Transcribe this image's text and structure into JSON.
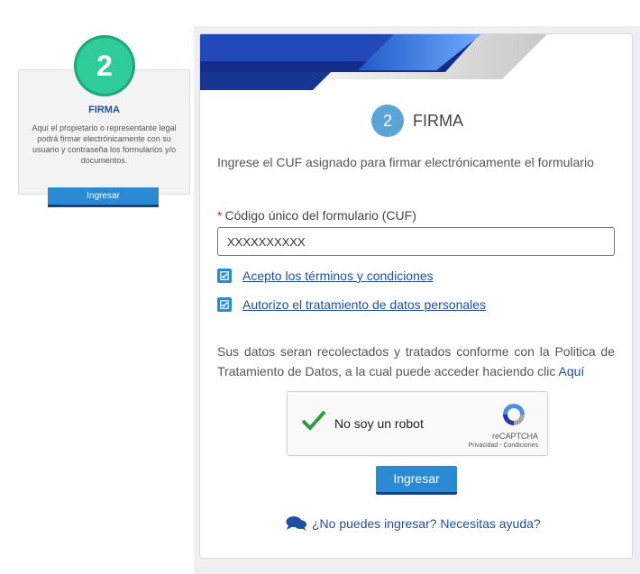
{
  "step_card": {
    "number": "2",
    "title": "FIRMA",
    "description": "Aquí el propietario o representante legal podrá firmar electrónicamente con su usuario y contraseña los formularios y/o documentos.",
    "button_label": "Ingresar"
  },
  "form": {
    "step_number": "2",
    "step_title": "FIRMA",
    "instruction": "Ingrese el CUF asignado para firmar electrónicamente el formulario",
    "required_mark": "*",
    "field_label": "Código único del formulario (CUF)",
    "field_value": "XXXXXXXXXX",
    "checkbox_terms": "Acepto los términos y condiciones",
    "checkbox_data": "Autorizo el tratamiento de datos personales",
    "privacy_text": "Sus datos seran recolectados y tratados conforme con la Politica de Tratamiento de Datos, a la cual puede acceder haciendo clic",
    "privacy_link": "Aquí",
    "submit_label": "Ingresar",
    "help_text": "¿No puedes ingresar? Necesitas ayuda?"
  },
  "recaptcha": {
    "label": "No soy un robot",
    "brand": "reCAPTCHA",
    "terms": "Privacidad - Condiciones"
  },
  "colors": {
    "accent_green": "#2ecc9a",
    "button_blue": "#2a8ad4",
    "link_blue": "#1f4fa0",
    "banner_navy": "#1a3a9c"
  }
}
